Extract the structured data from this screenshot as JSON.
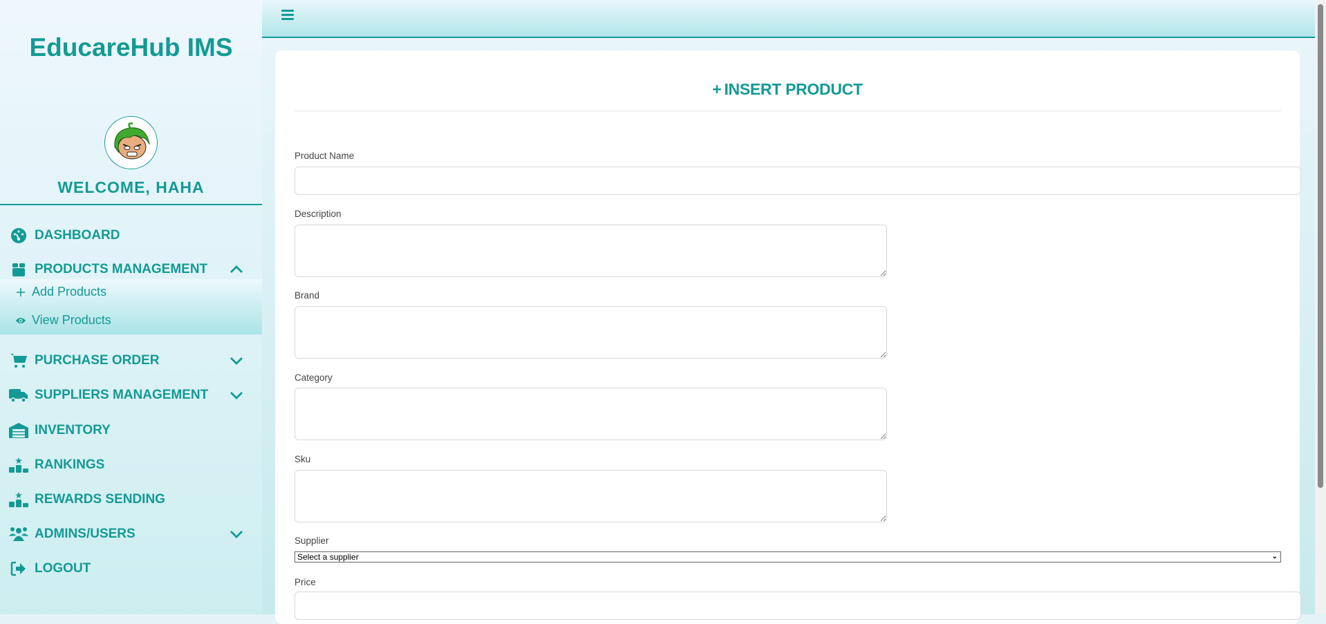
{
  "sidebar": {
    "brand": "EducareHub IMS",
    "welcome": "WELCOME, HAHA",
    "items": [
      {
        "label": "DASHBOARD"
      },
      {
        "label": "PRODUCTS MANAGEMENT"
      },
      {
        "label": "PURCHASE ORDER"
      },
      {
        "label": "SUPPLIERS MANAGEMENT"
      },
      {
        "label": "INVENTORY"
      },
      {
        "label": "RANKINGS"
      },
      {
        "label": "REWARDS SENDING"
      },
      {
        "label": "ADMINS/USERS"
      },
      {
        "label": "LOGOUT"
      }
    ],
    "submenu": [
      {
        "label": "Add Products"
      },
      {
        "label": "View Products"
      }
    ]
  },
  "form": {
    "title": "INSERT PRODUCT",
    "fields": {
      "product_name": {
        "label": "Product Name",
        "value": ""
      },
      "description": {
        "label": "Description",
        "value": ""
      },
      "brand": {
        "label": "Brand",
        "value": ""
      },
      "category": {
        "label": "Category",
        "value": ""
      },
      "sku": {
        "label": "Sku",
        "value": ""
      },
      "supplier": {
        "label": "Supplier",
        "selected": "Select a supplier"
      },
      "price": {
        "label": "Price",
        "value": ""
      }
    }
  },
  "colors": {
    "accent": "#139a94"
  }
}
